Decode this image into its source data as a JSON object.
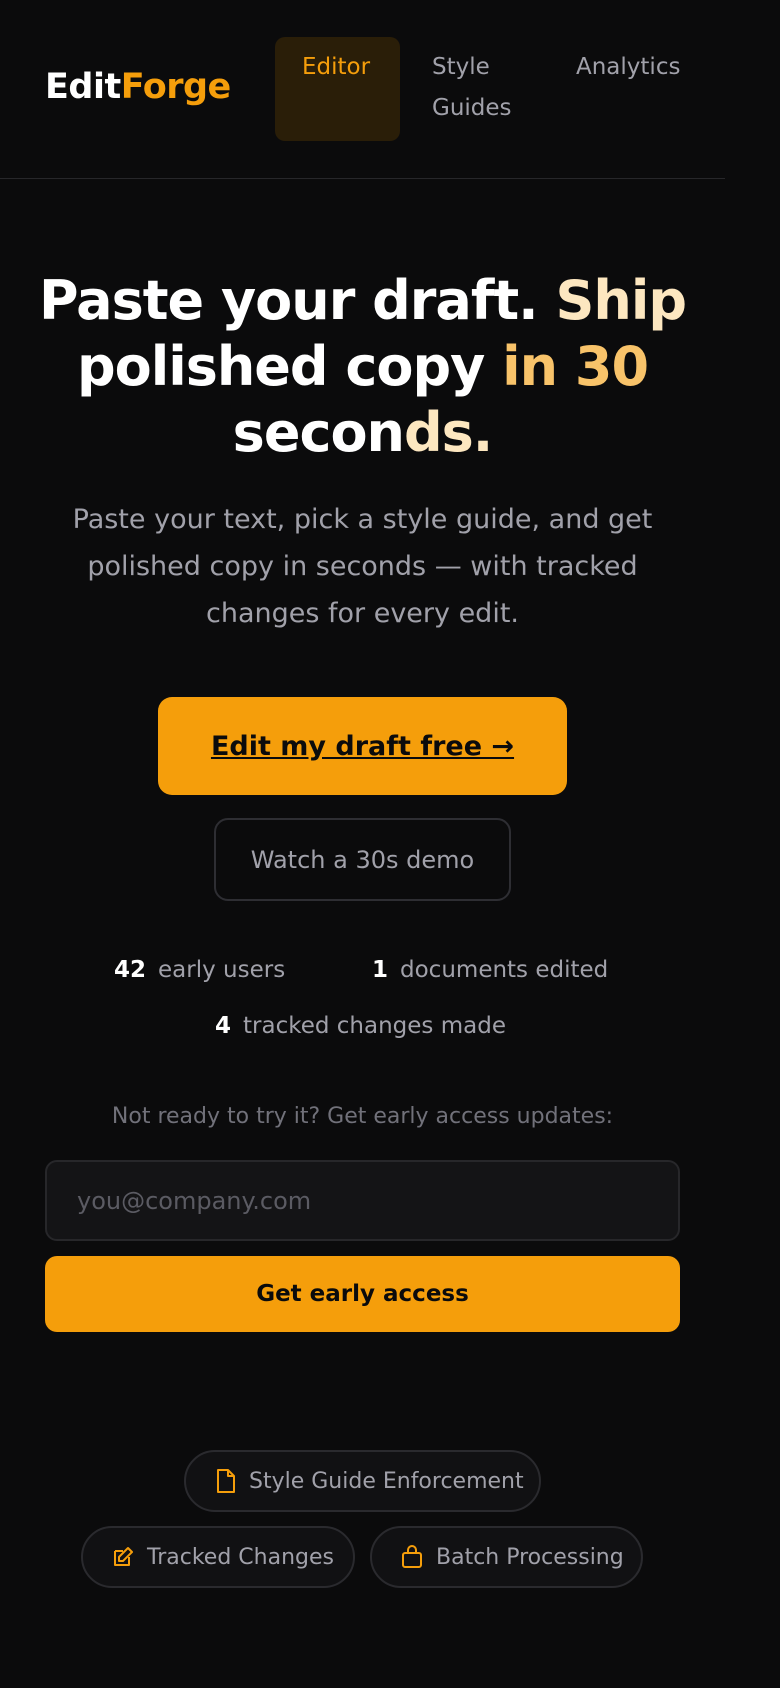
{
  "brand": {
    "part1": "Edit",
    "part2": "Forge"
  },
  "nav": {
    "editor": "Editor",
    "style_guides": "Style Guides",
    "analytics": "Analytics"
  },
  "hero": {
    "title_white1": "Paste your draft.",
    "title_accent1": "Ship",
    "title_white2": "polished copy",
    "title_accent2": "in 30",
    "title_white3": "secon",
    "title_accent3": "ds.",
    "subtitle": "Paste your text, pick a style guide, and get polished copy in seconds — with tracked changes for every edit."
  },
  "cta": {
    "primary": "Edit my draft free →",
    "secondary": "Watch a 30s demo"
  },
  "stats": [
    {
      "value": "42",
      "label": "early users"
    },
    {
      "value": "1",
      "label": "documents edited"
    },
    {
      "value": "4",
      "label": "tracked changes made"
    }
  ],
  "signup": {
    "label": "Not ready to try it? Get early access updates:",
    "placeholder": "you@company.com",
    "button": "Get early access"
  },
  "features": [
    {
      "label": "Style Guide Enforcement",
      "icon": "document-icon"
    },
    {
      "label": "Tracked Changes",
      "icon": "edit-icon"
    },
    {
      "label": "Batch Processing",
      "icon": "bag-icon"
    }
  ],
  "colors": {
    "accent": "#f59e0b",
    "background": "#0b0b0c"
  }
}
